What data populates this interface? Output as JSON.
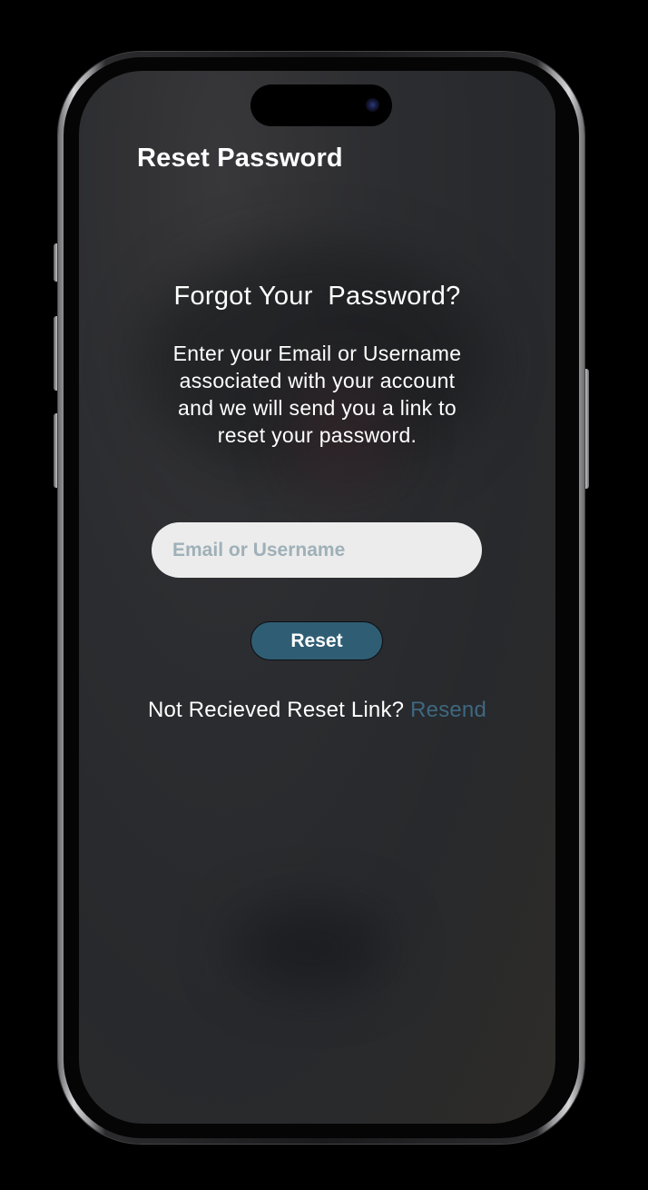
{
  "header": {
    "title": "Reset Password"
  },
  "main": {
    "heading": "Forgot Your  Password?",
    "description": "Enter your Email or Username associated with your account and we will send you a link to reset your password.",
    "input": {
      "placeholder": "Email or Username",
      "value": ""
    },
    "reset_label": "Reset",
    "resend_prompt": "Not Recieved Reset Link?",
    "resend_link": "Resend"
  },
  "device": {
    "icons": [
      "camera-icon"
    ]
  },
  "colors": {
    "button_bg": "#2f5d74",
    "link": "#3e6880",
    "input_bg": "#ececec",
    "placeholder": "#9fb0b8"
  }
}
